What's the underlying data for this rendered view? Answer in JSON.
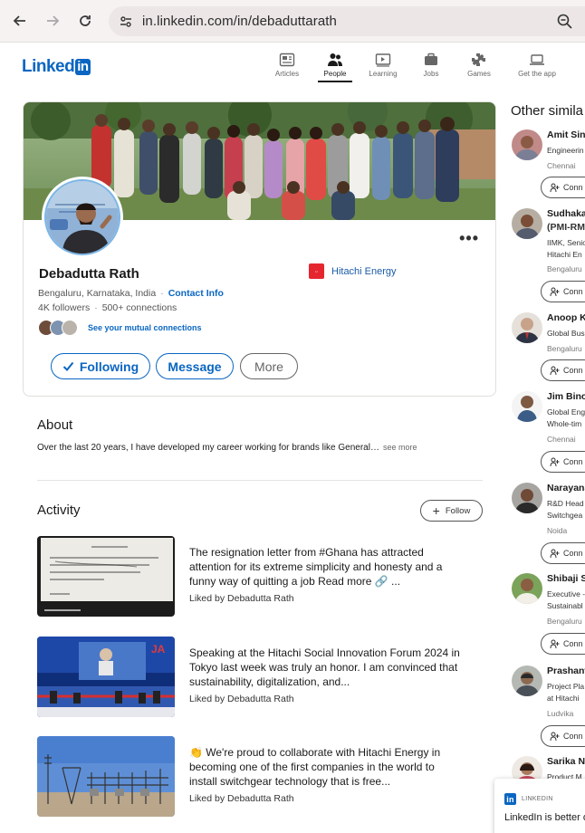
{
  "browser": {
    "url": "in.linkedin.com/in/debaduttarath"
  },
  "nav": {
    "logo_text": "Linked",
    "logo_badge": "in",
    "items": [
      {
        "label": "Articles",
        "icon": "articles-icon"
      },
      {
        "label": "People",
        "icon": "people-icon"
      },
      {
        "label": "Learning",
        "icon": "learning-icon"
      },
      {
        "label": "Jobs",
        "icon": "jobs-icon"
      },
      {
        "label": "Games",
        "icon": "games-icon"
      },
      {
        "label": "Get the app",
        "icon": "laptop-icon"
      }
    ],
    "active": "People"
  },
  "profile": {
    "name": "Debadutta Rath",
    "company": "Hitachi Energy",
    "location": "Bengaluru, Karnataka, India",
    "contact_info": "Contact Info",
    "followers": "4K followers",
    "connections": "500+ connections",
    "mutual": "See your mutual connections",
    "buttons": {
      "following": "Following",
      "message": "Message",
      "more": "More"
    }
  },
  "about": {
    "title": "About",
    "text": "Over the last 20 years, I have developed my career working for brands like General…",
    "see_more": "see more"
  },
  "activity": {
    "title": "Activity",
    "follow_label": "Follow",
    "posts": [
      {
        "text": "The resignation letter from #Ghana has attracted attention for its extreme simplicity and honesty and a funny way of quitting a job Read more 🔗 ...",
        "sub": "Liked by Debadutta Rath"
      },
      {
        "text": "Speaking at the Hitachi Social Innovation Forum 2024 in Tokyo last week was truly an honor. I am convinced that sustainability, digitalization, and...",
        "sub": "Liked by Debadutta Rath"
      },
      {
        "text": "👏 We're proud to collaborate with Hitachi Energy in becoming one of the first companies in the world to install switchgear technology that is free...",
        "sub": "Liked by Debadutta Rath"
      }
    ]
  },
  "similar": {
    "title": "Other simila",
    "connect_label": "Conn",
    "people": [
      {
        "name": "Amit Sin",
        "lines": [
          "Engineerin"
        ],
        "loc": "Chennai"
      },
      {
        "name": "Sudhaka",
        "lines": [
          "(PMI-RM",
          "IIMK, Senio",
          "Hitachi En"
        ],
        "loc": "Bengaluru"
      },
      {
        "name": "Anoop K",
        "lines": [
          "Global Bus"
        ],
        "loc": "Bengaluru"
      },
      {
        "name": "Jim Bino",
        "lines": [
          "Global Eng",
          "Whole-tim"
        ],
        "loc": "Chennai"
      },
      {
        "name": "Narayana",
        "lines": [
          "R&D Head",
          "Switchgea"
        ],
        "loc": "Noida"
      },
      {
        "name": "Shibaji S",
        "lines": [
          "Executive -",
          "Sustainabl"
        ],
        "loc": "Bengaluru"
      },
      {
        "name": "Prashant",
        "lines": [
          "Project Pla",
          "at Hitachi"
        ],
        "loc": "Ludvika"
      },
      {
        "name": "Sarika Na",
        "lines": [
          "Product M"
        ],
        "loc": ""
      }
    ]
  },
  "popup": {
    "brand": "LINKEDIN",
    "badge": "in",
    "text": "LinkedIn is better o"
  },
  "colors": {
    "accent": "#0a66c2",
    "company_logo": "#e5262f"
  }
}
